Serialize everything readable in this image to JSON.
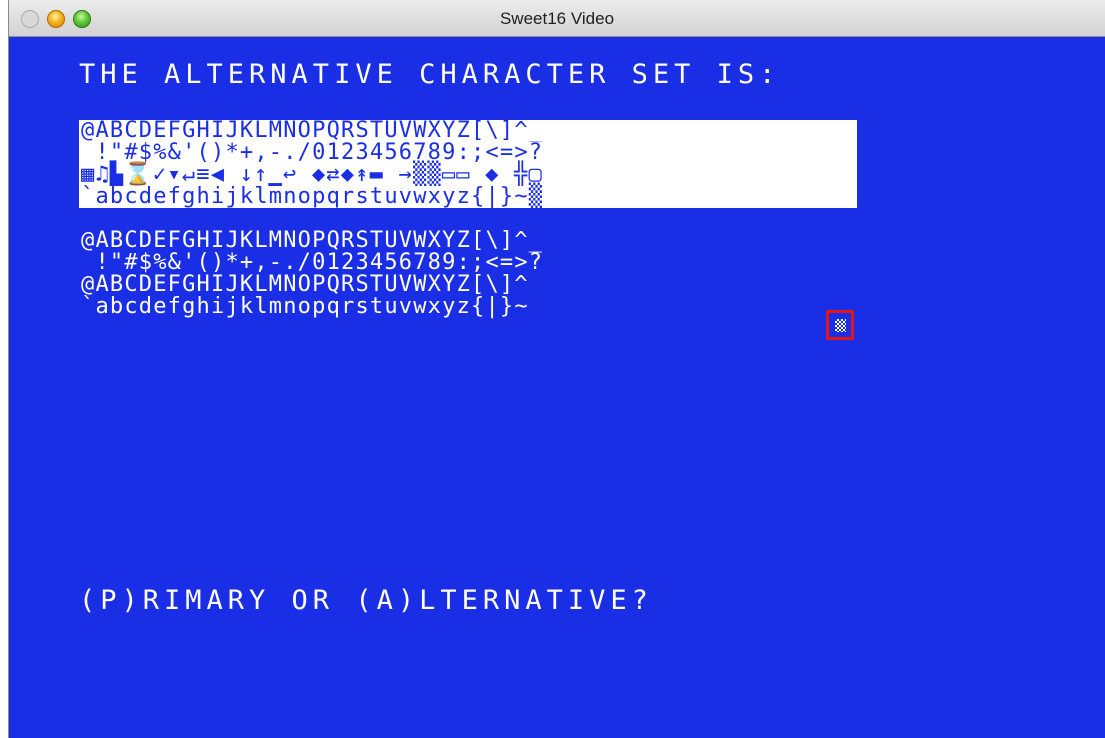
{
  "window": {
    "title": "Sweet16 Video"
  },
  "screen": {
    "heading": "THE ALTERNATIVE CHARACTER SET IS:",
    "rows": [
      "@ABCDEFGHIJKLMNOPQRSTUVWXYZ[\\]^_",
      " !\"#$%&'()*+,-./0123456789:;<=>?",
      "▦♫▙⌛✓▾↵≡◀ ↓↑▁↩ ◆⇄◆↟▬ →▒▒▭▭ ◆ ╬▢",
      "`abcdefghijklmnopqrstuvwxyz{|}~▒",
      "@ABCDEFGHIJKLMNOPQRSTUVWXYZ[\\]^_",
      " !\"#$%&'()*+,-./0123456789:;<=>?",
      "@ABCDEFGHIJKLMNOPQRSTUVWXYZ[\\]^",
      "`abcdefghijklmnopqrstuvwxyz{|}~"
    ],
    "prompt": "(P)RIMARY OR (A)LTERNATIVE?"
  },
  "colors": {
    "screen_background": "#1a2ee6",
    "text": "#ffffff",
    "highlight_border": "#e11616"
  }
}
